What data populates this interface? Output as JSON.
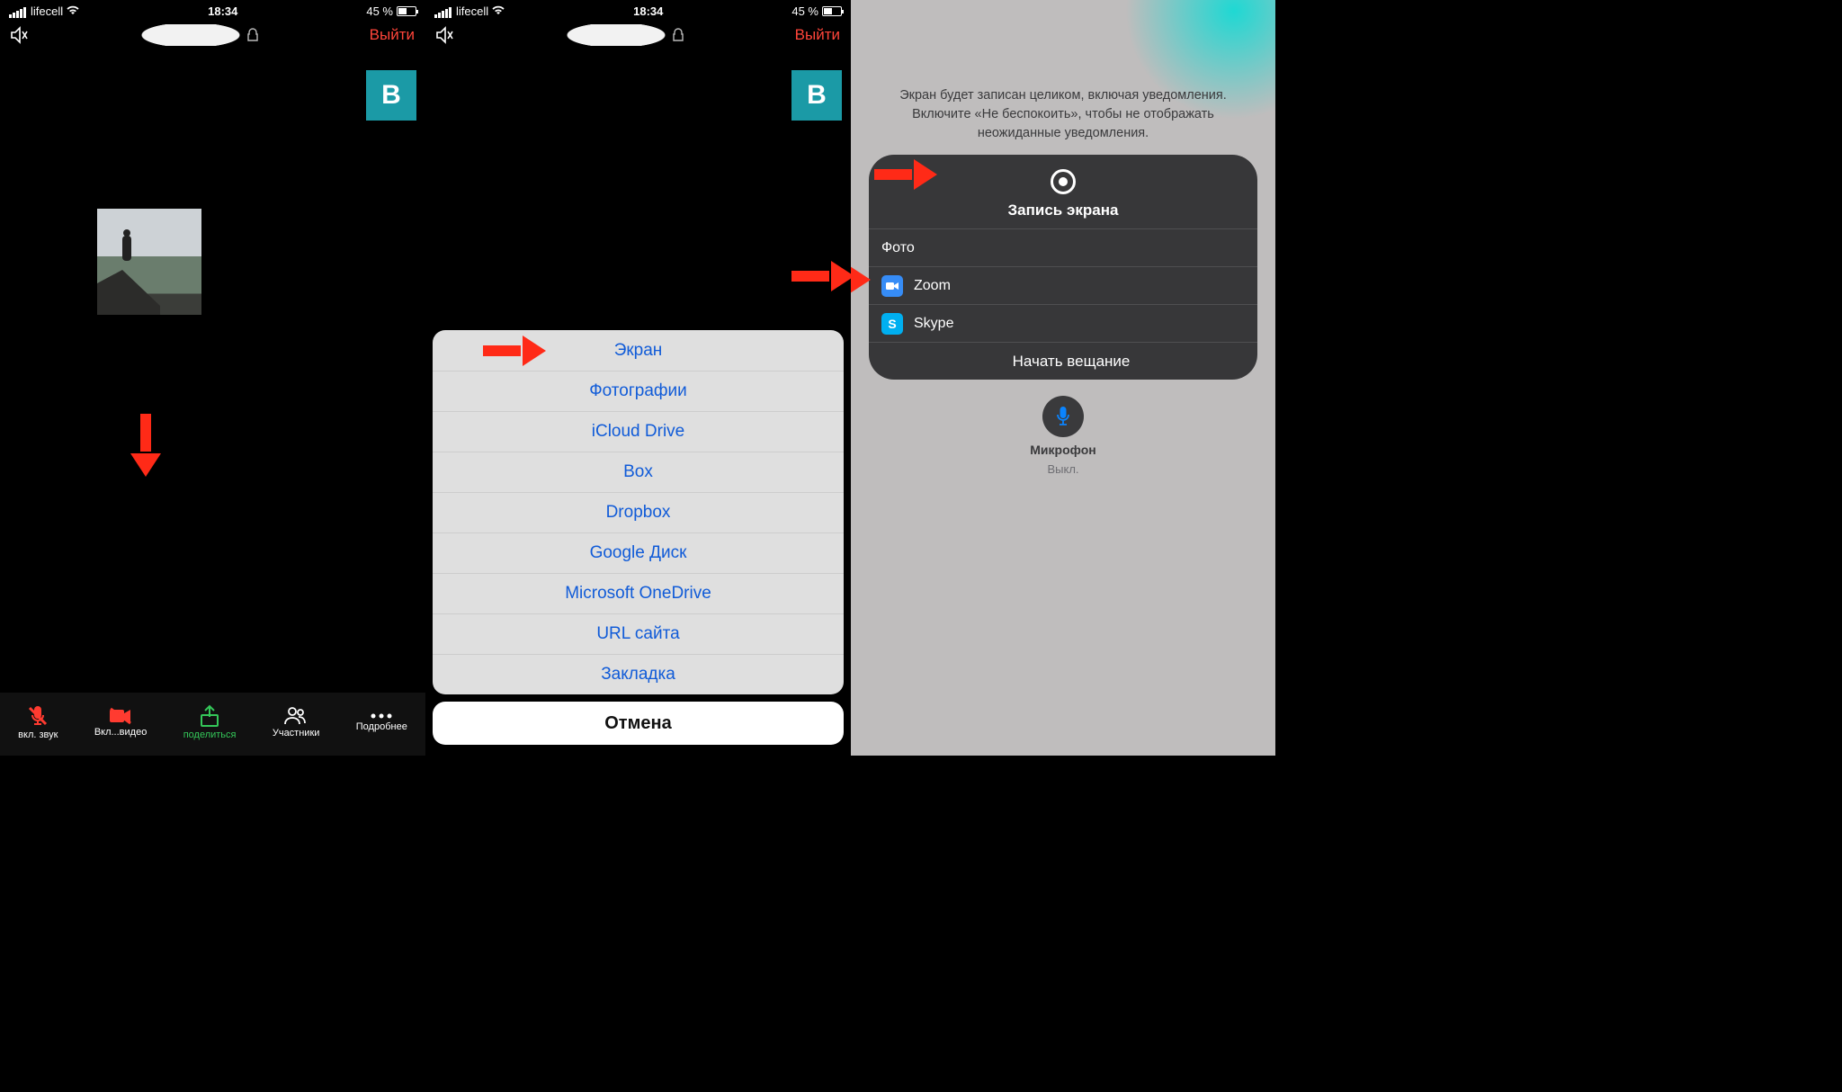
{
  "status": {
    "carrier": "lifecell",
    "time": "18:34",
    "battery_pct": "45 %"
  },
  "topbar": {
    "exit": "Выйти"
  },
  "tile_letter": "В",
  "nav": {
    "audio": "вкл. звук",
    "video": "Вкл...видео",
    "share": "поделиться",
    "participants": "Участники",
    "more": "Подробнее"
  },
  "sheet": {
    "items": [
      "Экран",
      "Фотографии",
      "iCloud Drive",
      "Box",
      "Dropbox",
      "Google Диск",
      "Microsoft OneDrive",
      "URL сайта",
      "Закладка"
    ],
    "cancel": "Отмена"
  },
  "p3": {
    "note": "Экран будет записан целиком, включая уведомления. Включите «Не беспокоить», чтобы не отображать неожиданные уведомления.",
    "rec_title": "Запись экрана",
    "apps": {
      "photo": "Фото",
      "zoom": "Zoom",
      "skype": "Skype"
    },
    "start": "Начать вещание",
    "mic_label": "Микрофон",
    "mic_state": "Выкл."
  }
}
